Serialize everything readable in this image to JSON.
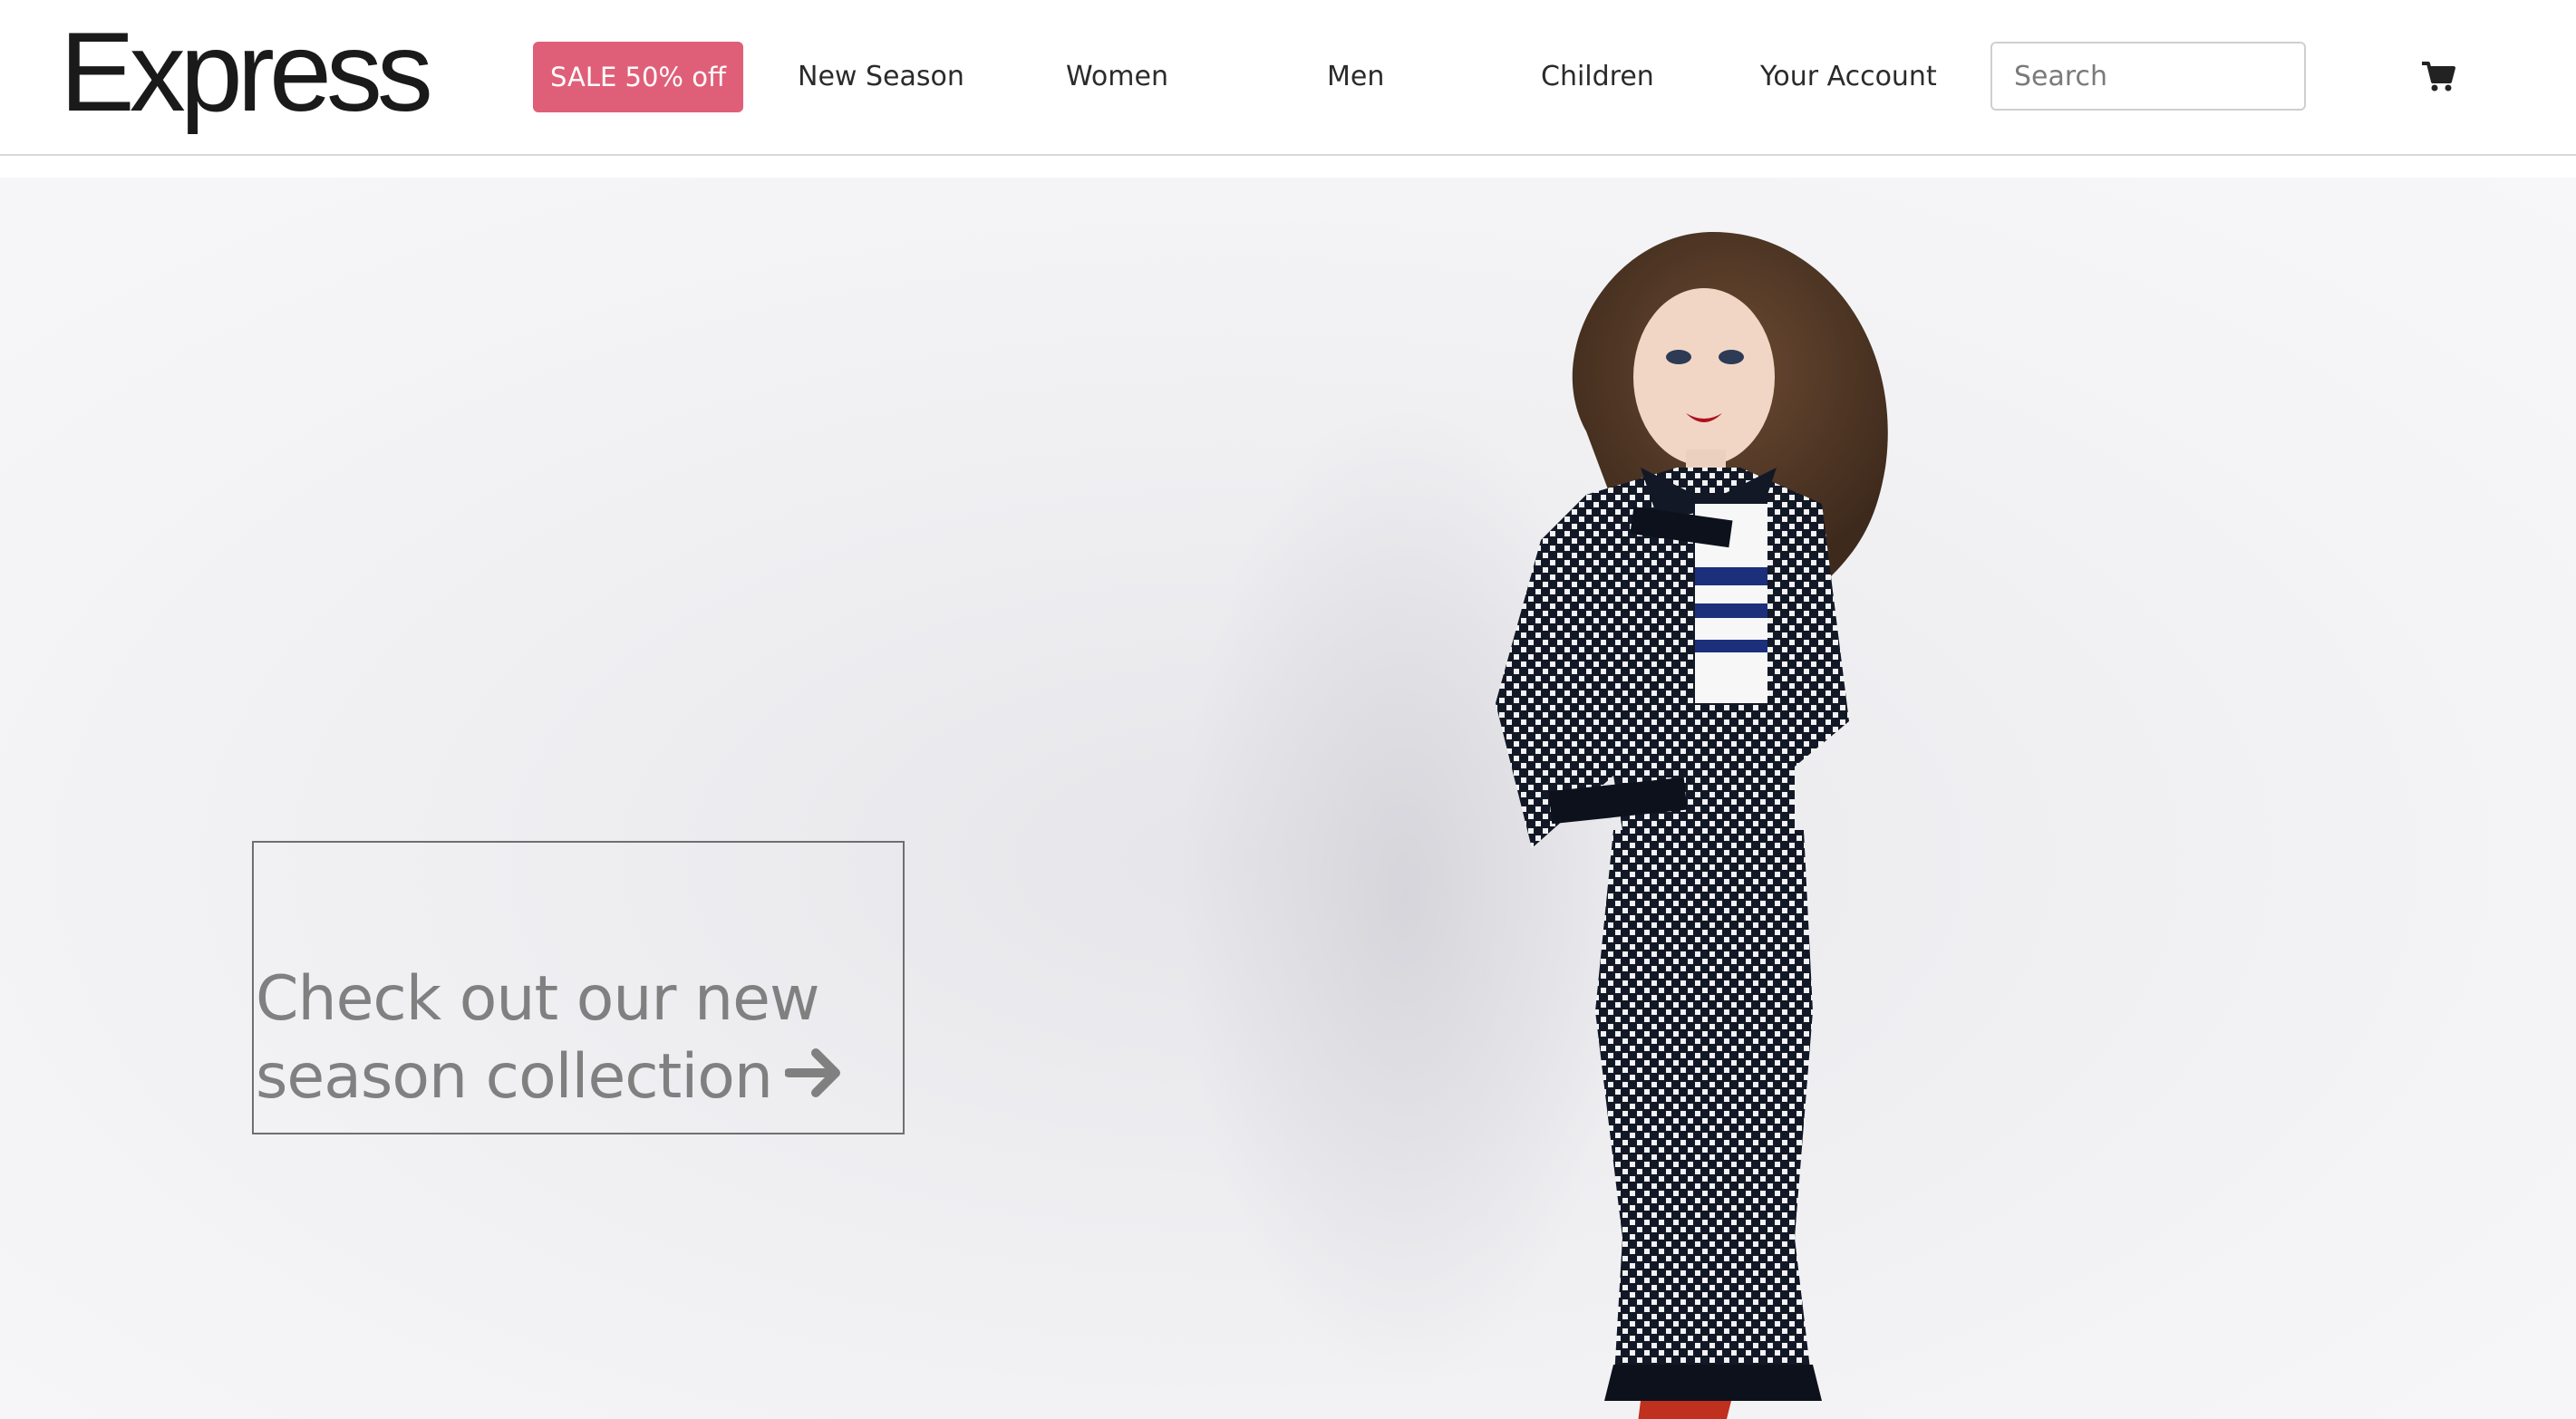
{
  "header": {
    "logo_text": "Express",
    "sale_label": "SALE 50% off",
    "nav": [
      {
        "label": "New Season"
      },
      {
        "label": "Women"
      },
      {
        "label": "Men"
      },
      {
        "label": "Children"
      },
      {
        "label": "Your Account"
      }
    ],
    "search": {
      "placeholder": "Search",
      "value": ""
    },
    "cart_icon": "shopping-cart-icon"
  },
  "hero": {
    "cta_line1": "Check out our new",
    "cta_line2": "season collection",
    "cta_icon": "arrow-right-icon"
  },
  "colors": {
    "sale": "#e05f78",
    "cta_text": "#808080",
    "background": "#f4f4f6"
  }
}
